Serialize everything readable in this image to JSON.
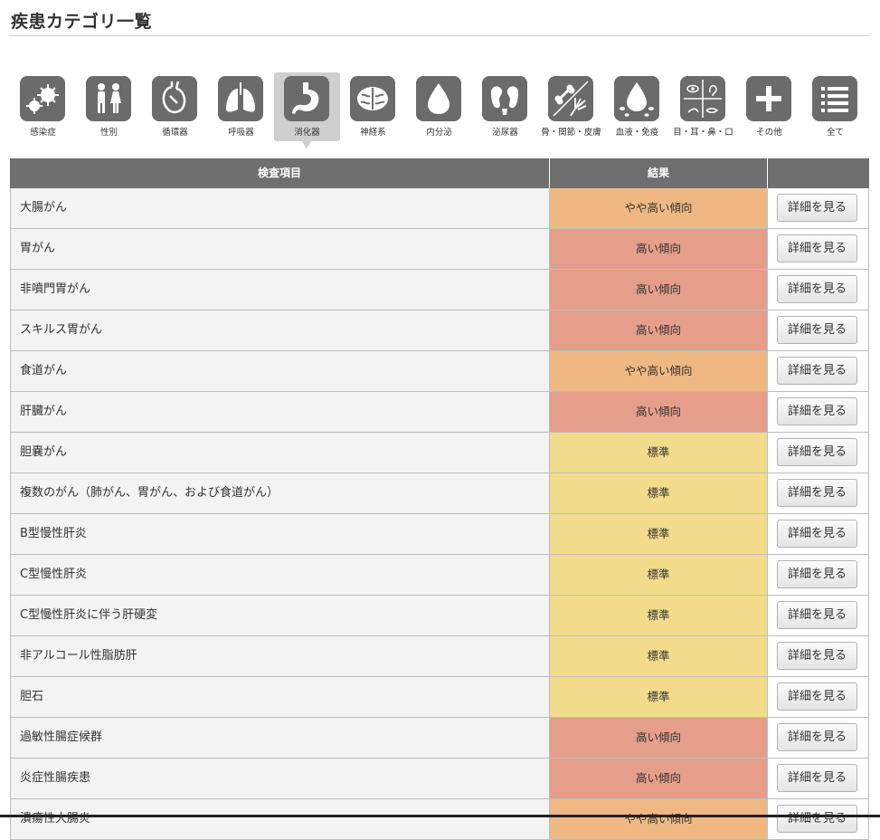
{
  "page": {
    "title": "疾患カテゴリ一覧"
  },
  "colors": {
    "high": "#e59e89",
    "slightly_high": "#efb882",
    "standard": "#f2db8b",
    "header": "#6f6f6f",
    "icon_bg": "#6b6b6b"
  },
  "categories": [
    {
      "label": "感染症",
      "icon": "virus-icon"
    },
    {
      "label": "性別",
      "icon": "gender-icon"
    },
    {
      "label": "循環器",
      "icon": "heart-icon"
    },
    {
      "label": "呼吸器",
      "icon": "lungs-icon"
    },
    {
      "label": "消化器",
      "icon": "stomach-icon",
      "selected": true
    },
    {
      "label": "神経系",
      "icon": "brain-icon"
    },
    {
      "label": "内分泌",
      "icon": "drop-icon"
    },
    {
      "label": "泌尿器",
      "icon": "kidney-icon"
    },
    {
      "label": "骨・関節・皮膚",
      "icon": "bone-hand-icon"
    },
    {
      "label": "血液・免疫",
      "icon": "blood-drop-icon"
    },
    {
      "label": "目・耳・鼻・口",
      "icon": "face-parts-icon"
    },
    {
      "label": "その他",
      "icon": "plus-icon"
    },
    {
      "label": "全て",
      "icon": "list-icon"
    }
  ],
  "table": {
    "headers": {
      "item": "検査項目",
      "result": "結果",
      "action": ""
    },
    "button_label": "詳細を見る",
    "rows": [
      {
        "name": "大腸がん",
        "result": "やや高い傾向",
        "level": "slightly_high"
      },
      {
        "name": "胃がん",
        "result": "高い傾向",
        "level": "high"
      },
      {
        "name": "非噴門胃がん",
        "result": "高い傾向",
        "level": "high"
      },
      {
        "name": "スキルス胃がん",
        "result": "高い傾向",
        "level": "high"
      },
      {
        "name": "食道がん",
        "result": "やや高い傾向",
        "level": "slightly_high"
      },
      {
        "name": "肝臓がん",
        "result": "高い傾向",
        "level": "high"
      },
      {
        "name": "胆嚢がん",
        "result": "標準",
        "level": "standard"
      },
      {
        "name": "複数のがん（肺がん、胃がん、および食道がん）",
        "result": "標準",
        "level": "standard"
      },
      {
        "name": "B型慢性肝炎",
        "result": "標準",
        "level": "standard"
      },
      {
        "name": "C型慢性肝炎",
        "result": "標準",
        "level": "standard"
      },
      {
        "name": "C型慢性肝炎に伴う肝硬変",
        "result": "標準",
        "level": "standard"
      },
      {
        "name": "非アルコール性脂肪肝",
        "result": "標準",
        "level": "standard"
      },
      {
        "name": "胆石",
        "result": "標準",
        "level": "standard"
      },
      {
        "name": "過敏性腸症候群",
        "result": "高い傾向",
        "level": "high"
      },
      {
        "name": "炎症性腸疾患",
        "result": "高い傾向",
        "level": "high"
      },
      {
        "name": "潰瘍性大腸炎",
        "result": "やや高い傾向",
        "level": "slightly_high"
      }
    ]
  }
}
